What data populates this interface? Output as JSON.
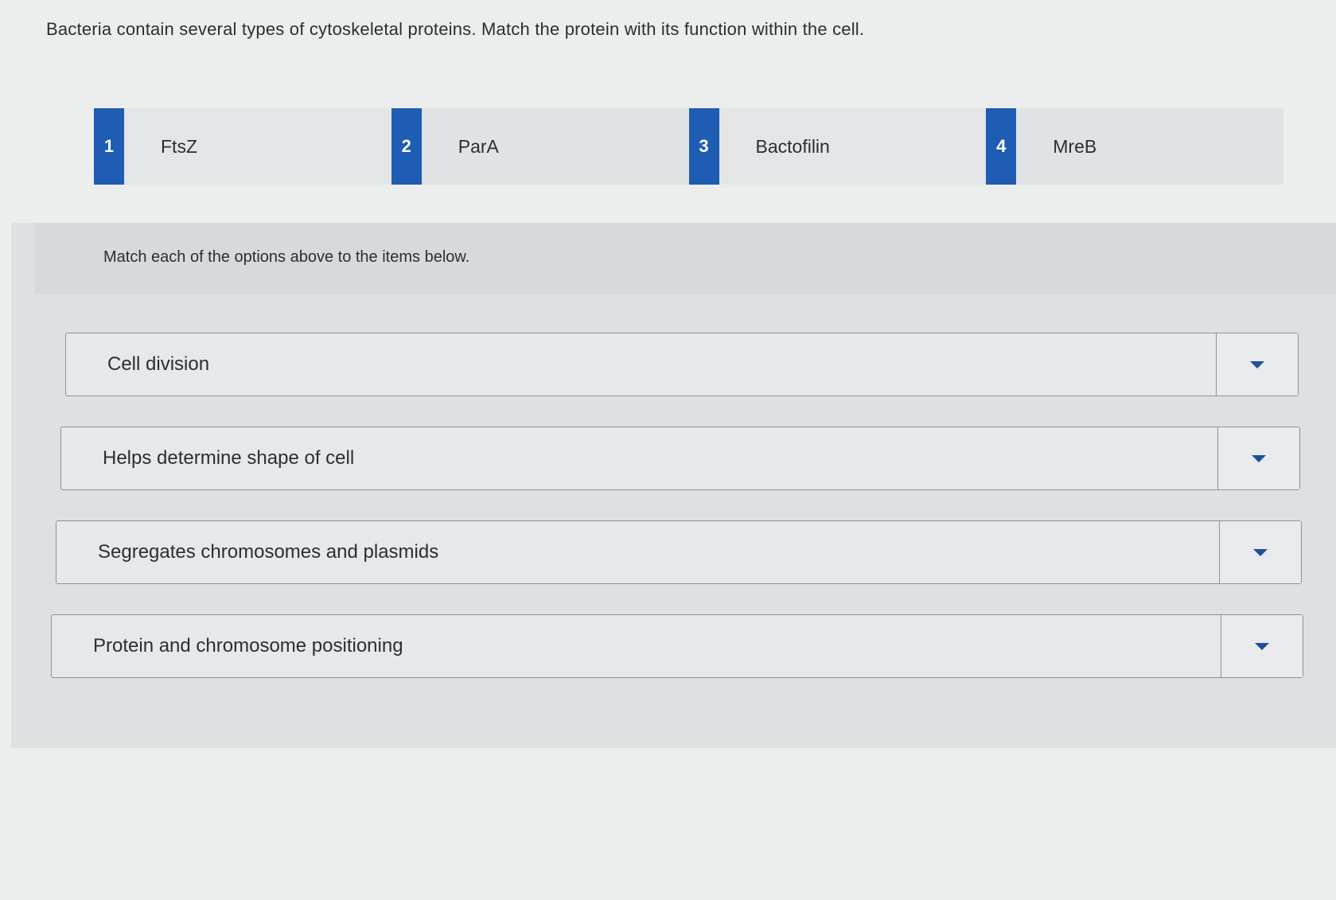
{
  "question": "Bacteria contain several types of cytoskeletal proteins. Match the protein with its function within the cell.",
  "options": [
    {
      "number": "1",
      "label": "FtsZ"
    },
    {
      "number": "2",
      "label": "ParA"
    },
    {
      "number": "3",
      "label": "Bactofilin"
    },
    {
      "number": "4",
      "label": "MreB"
    }
  ],
  "instructions": "Match each of the options above to the items below.",
  "items": [
    {
      "label": "Cell division"
    },
    {
      "label": "Helps determine shape of cell"
    },
    {
      "label": "Segregates chromosomes and plasmids"
    },
    {
      "label": "Protein and chromosome positioning"
    }
  ],
  "icons": {
    "dropdown": "caret-down-icon"
  },
  "colors": {
    "accent": "#1f5cb3",
    "caret": "#1f4f9a"
  }
}
